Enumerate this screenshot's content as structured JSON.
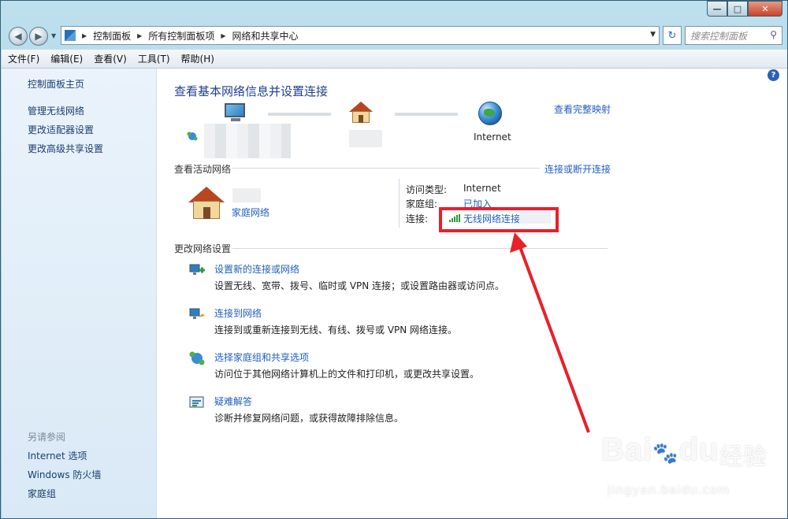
{
  "breadcrumb": {
    "items": [
      "控制面板",
      "所有控制面板项",
      "网络和共享中心"
    ]
  },
  "search": {
    "placeholder": "搜索控制面板"
  },
  "menubar": {
    "items": [
      "文件(F)",
      "编辑(E)",
      "查看(V)",
      "工具(T)",
      "帮助(H)"
    ]
  },
  "sidebar": {
    "items": [
      "控制面板主页",
      "管理无线网络",
      "更改适配器设置",
      "更改高级共享设置"
    ],
    "see_also_heading": "另请参阅",
    "see_also": [
      "Internet 选项",
      "Windows 防火墙",
      "家庭组"
    ]
  },
  "main": {
    "title": "查看基本网络信息并设置连接",
    "full_map_link": "查看完整映射",
    "internet_label": "Internet",
    "active_heading": "查看活动网络",
    "connect_disconnect_link": "连接或断开连接",
    "network_type": "家庭网络",
    "access_type_label": "访问类型:",
    "access_type_value": "Internet",
    "homegroup_label": "家庭组:",
    "homegroup_value": "已加入",
    "connection_label": "连接:",
    "connection_value": "无线网络连接",
    "change_heading": "更改网络设置",
    "tasks": [
      {
        "link": "设置新的连接或网络",
        "desc": "设置无线、宽带、拨号、临时或 VPN 连接；或设置路由器或访问点。"
      },
      {
        "link": "连接到网络",
        "desc": "连接到或重新连接到无线、有线、拨号或 VPN 网络连接。"
      },
      {
        "link": "选择家庭组和共享选项",
        "desc": "访问位于其他网络计算机上的文件和打印机，或更改共享设置。"
      },
      {
        "link": "疑难解答",
        "desc": "诊断并修复网络问题，或获得故障排除信息。"
      }
    ]
  },
  "watermark": {
    "brand": "Bai",
    "brand2": "du",
    "cn": "经验",
    "url": "jingyan.baidu.com"
  },
  "colors": {
    "accent_link": "#1f5fbf",
    "title": "#1e3f8f",
    "highlight": "#e8202a"
  },
  "icons": [
    "back-icon",
    "forward-icon",
    "refresh-icon",
    "search-icon",
    "help-icon",
    "computer-icon",
    "house-icon",
    "globe-icon",
    "signal-icon"
  ]
}
